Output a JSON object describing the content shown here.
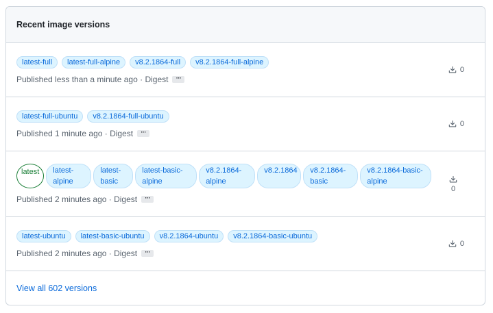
{
  "header": {
    "title": "Recent image versions"
  },
  "versions": [
    {
      "tags": [
        "latest-full",
        "latest-full-alpine",
        "v8.2.1864-full",
        "v8.2.1864-full-alpine"
      ],
      "published": "Published less than a minute ago",
      "digest_label": "Digest",
      "ellipsis": "···",
      "downloads": "0"
    },
    {
      "tags": [
        "latest-full-ubuntu",
        "v8.2.1864-full-ubuntu"
      ],
      "published": "Published 1 minute ago",
      "digest_label": "Digest",
      "ellipsis": "···",
      "downloads": "0"
    },
    {
      "tags": [
        "latest",
        "latest-alpine",
        "latest-basic",
        "latest-basic-alpine",
        "v8.2.1864-alpine",
        "v8.2.1864",
        "v8.2.1864-basic",
        "v8.2.1864-basic-alpine"
      ],
      "published": "Published 2 minutes ago",
      "digest_label": "Digest",
      "ellipsis": "···",
      "downloads": "0"
    },
    {
      "tags": [
        "latest-ubuntu",
        "latest-basic-ubuntu",
        "v8.2.1864-ubuntu",
        "v8.2.1864-basic-ubuntu"
      ],
      "published": "Published 2 minutes ago",
      "digest_label": "Digest",
      "ellipsis": "···",
      "downloads": "0"
    }
  ],
  "footer": {
    "view_all": "View all 602 versions"
  },
  "icons": {
    "download": "download-icon"
  },
  "colors": {
    "link": "#0969da",
    "latest_tag": "#1a7f37",
    "muted": "#59636e",
    "border": "#d0d7de"
  }
}
